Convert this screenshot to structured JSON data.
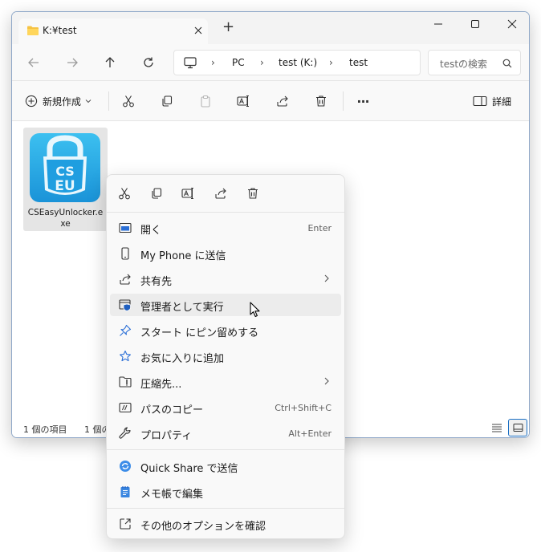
{
  "window": {
    "tab_title": "K:¥test",
    "new_tab_label": "+"
  },
  "address": {
    "crumbs": [
      "PC",
      "test (K:)",
      "test"
    ],
    "separator": "›",
    "search_placeholder": "testの検索"
  },
  "toolbar": {
    "new_label": "新規作成",
    "more_label": "···",
    "details_label": "詳細"
  },
  "file": {
    "name_line1": "CSEasyUnlocker.e",
    "name_line2": "xe",
    "logo_text_top": "CS",
    "logo_text_bottom": "EU"
  },
  "status": {
    "item_count": "1 個の項目",
    "selected_count": "1 個の"
  },
  "context_menu": {
    "items": [
      {
        "label": "開く",
        "shortcut": "Enter"
      },
      {
        "label": "My Phone に送信",
        "shortcut": ""
      },
      {
        "label": "共有先",
        "shortcut": ""
      },
      {
        "label": "管理者として実行",
        "shortcut": ""
      },
      {
        "label": "スタート にピン留めする",
        "shortcut": ""
      },
      {
        "label": "お気に入りに追加",
        "shortcut": ""
      },
      {
        "label": "圧縮先...",
        "shortcut": ""
      },
      {
        "label": "パスのコピー",
        "shortcut": "Ctrl+Shift+C"
      },
      {
        "label": "プロパティ",
        "shortcut": "Alt+Enter"
      },
      {
        "label": "Quick Share で送信",
        "shortcut": ""
      },
      {
        "label": "メモ帳で編集",
        "shortcut": ""
      },
      {
        "label": "その他のオプションを確認",
        "shortcut": ""
      }
    ]
  },
  "colors": {
    "accent": "#0067c0",
    "logo_blue": "#29a8e6",
    "hover": "#ececec"
  }
}
